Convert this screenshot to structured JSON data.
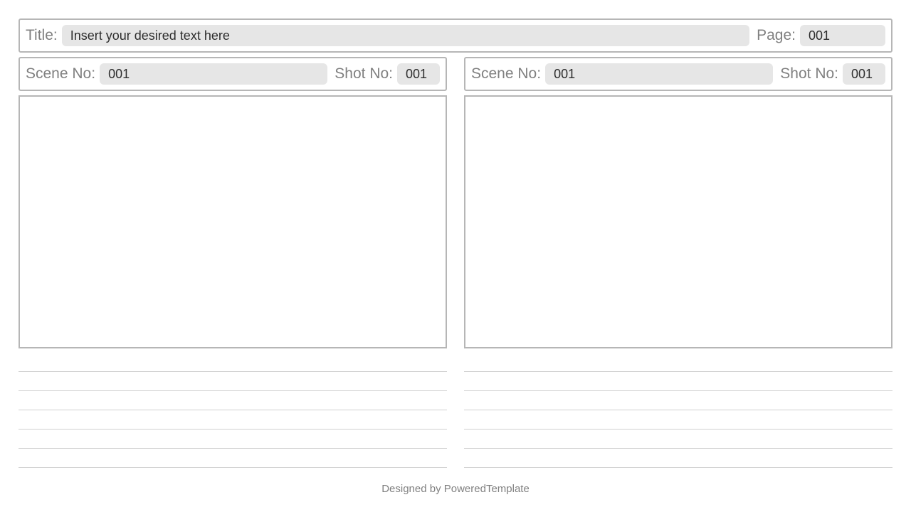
{
  "header": {
    "title_label": "Title:",
    "title_value": "Insert your desired text here",
    "page_label": "Page:",
    "page_value": "001"
  },
  "panels": [
    {
      "scene_label": "Scene No:",
      "scene_value": "001",
      "shot_label": "Shot No:",
      "shot_value": "001"
    },
    {
      "scene_label": "Scene No:",
      "scene_value": "001",
      "shot_label": "Shot No:",
      "shot_value": "001"
    }
  ],
  "footer": "Designed by PoweredTemplate"
}
